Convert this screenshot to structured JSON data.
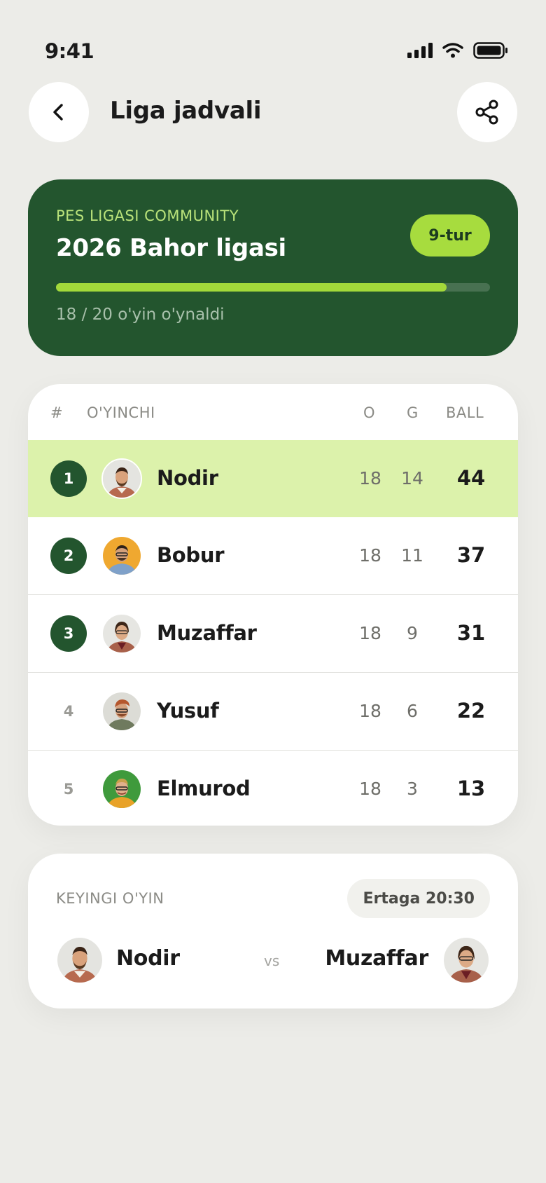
{
  "status_bar": {
    "time": "9:41"
  },
  "header": {
    "title": "Liga jadvali"
  },
  "league": {
    "kicker": "PES LIGASI COMMUNITY",
    "title": "2026 Bahor ligasi",
    "round_badge": "9-tur",
    "progress_text": "18 / 20 o'yin o'ynaldi",
    "progress_fraction": 0.9
  },
  "standings": {
    "columns": {
      "rank": "#",
      "player": "O'YINCHI",
      "played": "O",
      "won": "G",
      "points": "BALL"
    },
    "rows": [
      {
        "rank": "1",
        "name": "Nodir",
        "played": "18",
        "won": "14",
        "points": "44"
      },
      {
        "rank": "2",
        "name": "Bobur",
        "played": "18",
        "won": "11",
        "points": "37"
      },
      {
        "rank": "3",
        "name": "Muzaffar",
        "played": "18",
        "won": "9",
        "points": "31"
      },
      {
        "rank": "4",
        "name": "Yusuf",
        "played": "18",
        "won": "6",
        "points": "22"
      },
      {
        "rank": "5",
        "name": "Elmurod",
        "played": "18",
        "won": "3",
        "points": "13"
      }
    ]
  },
  "next_match": {
    "label": "KEYINGI O'YIN",
    "time": "Ertaga 20:30",
    "home": "Nodir",
    "vs": "vs",
    "away": "Muzaffar"
  },
  "colors": {
    "primary_green": "#23552e",
    "accent_lime": "#a7dc3e",
    "leader_row": "#dcf2ab",
    "background": "#ecece8"
  }
}
